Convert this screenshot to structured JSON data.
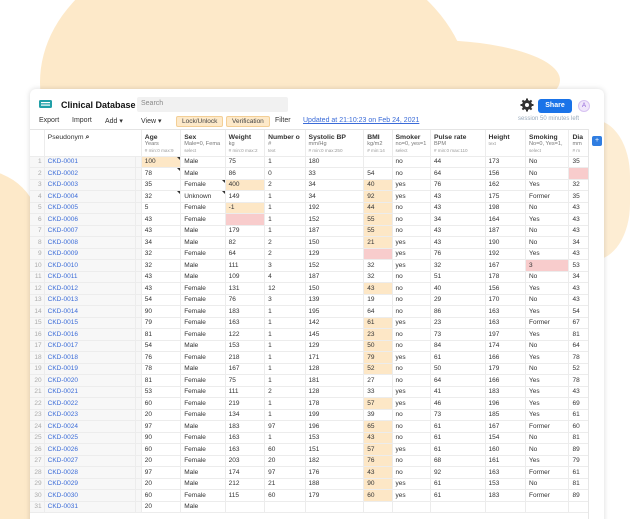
{
  "app": {
    "title": "Clinical Database",
    "search_placeholder": "Search",
    "share_label": "Share",
    "avatar": "A",
    "saved_text": "session 50 minutes left"
  },
  "toolbar": {
    "export": "Export",
    "import": "Import",
    "add": "Add ▾",
    "view": "View ▾",
    "lock": "Lock/Unlock",
    "verify": "Verification",
    "filter": "Filter",
    "updated": "Updated at 21:10:23 on Feb 24, 2021"
  },
  "columns": [
    {
      "name": "Pseudonym",
      "sub": "",
      "sub2": ""
    },
    {
      "name": "Age",
      "sub": "Years",
      "sub2": "# min:0 max:9"
    },
    {
      "name": "Sex",
      "sub": "Male=0, Fema",
      "sub2": "select"
    },
    {
      "name": "Weight",
      "sub": "kg",
      "sub2": "# min:0 max:2"
    },
    {
      "name": "Number o",
      "sub": "#",
      "sub2": "text"
    },
    {
      "name": "Systolic BP",
      "sub": "mm/Hg",
      "sub2": "# min:0 max:250"
    },
    {
      "name": "BMI",
      "sub": "kg/m2",
      "sub2": "# min:14"
    },
    {
      "name": "Smoker",
      "sub": "no=0, yes=1",
      "sub2": "select"
    },
    {
      "name": "Pulse rate",
      "sub": "BPM",
      "sub2": "# min:0 max:110"
    },
    {
      "name": "Height",
      "sub": "",
      "sub2": "text"
    },
    {
      "name": "Smoking",
      "sub": "No=0, Yes=1,",
      "sub2": "select"
    },
    {
      "name": "Dia",
      "sub": "mm",
      "sub2": "# m"
    }
  ],
  "rows": [
    [
      "1",
      "CKD-0001",
      "100",
      "Male",
      "75",
      "1",
      "180",
      "",
      "no",
      "44",
      "173",
      "No",
      "35"
    ],
    [
      "2",
      "CKD-0002",
      "78",
      "Male",
      "86",
      "0",
      "33",
      "54",
      "no",
      "64",
      "156",
      "No",
      ""
    ],
    [
      "3",
      "CKD-0003",
      "35",
      "Female",
      "400",
      "2",
      "34",
      "40",
      "yes",
      "76",
      "162",
      "Yes",
      "32"
    ],
    [
      "4",
      "CKD-0004",
      "32",
      "Unknown",
      "149",
      "1",
      "34",
      "92",
      "yes",
      "43",
      "175",
      "Former",
      "35"
    ],
    [
      "5",
      "CKD-0005",
      "5",
      "Female",
      "-1",
      "1",
      "192",
      "44",
      "no",
      "43",
      "198",
      "No",
      "43"
    ],
    [
      "6",
      "CKD-0006",
      "43",
      "Female",
      "",
      "1",
      "152",
      "55",
      "no",
      "34",
      "164",
      "Yes",
      "43"
    ],
    [
      "7",
      "CKD-0007",
      "43",
      "Male",
      "179",
      "1",
      "187",
      "55",
      "no",
      "43",
      "187",
      "No",
      "43"
    ],
    [
      "8",
      "CKD-0008",
      "34",
      "Male",
      "82",
      "2",
      "150",
      "21",
      "yes",
      "43",
      "190",
      "No",
      "34"
    ],
    [
      "9",
      "CKD-0009",
      "32",
      "Female",
      "64",
      "2",
      "129",
      "",
      "yes",
      "76",
      "192",
      "Yes",
      "43"
    ],
    [
      "10",
      "CKD-0010",
      "32",
      "Male",
      "111",
      "3",
      "152",
      "32",
      "yes",
      "32",
      "167",
      "3",
      "53"
    ],
    [
      "11",
      "CKD-0011",
      "43",
      "Male",
      "109",
      "4",
      "187",
      "32",
      "no",
      "51",
      "178",
      "No",
      "34"
    ],
    [
      "12",
      "CKD-0012",
      "43",
      "Female",
      "131",
      "12",
      "150",
      "43",
      "no",
      "40",
      "156",
      "Yes",
      "43"
    ],
    [
      "13",
      "CKD-0013",
      "54",
      "Female",
      "76",
      "3",
      "139",
      "19",
      "no",
      "29",
      "170",
      "No",
      "43"
    ],
    [
      "14",
      "CKD-0014",
      "90",
      "Female",
      "183",
      "1",
      "195",
      "64",
      "no",
      "86",
      "163",
      "Yes",
      "54"
    ],
    [
      "15",
      "CKD-0015",
      "79",
      "Female",
      "163",
      "1",
      "142",
      "61",
      "yes",
      "23",
      "163",
      "Former",
      "67"
    ],
    [
      "16",
      "CKD-0016",
      "81",
      "Female",
      "122",
      "1",
      "145",
      "23",
      "no",
      "73",
      "197",
      "Yes",
      "81"
    ],
    [
      "17",
      "CKD-0017",
      "54",
      "Male",
      "153",
      "1",
      "129",
      "50",
      "no",
      "84",
      "174",
      "No",
      "64"
    ],
    [
      "18",
      "CKD-0018",
      "76",
      "Female",
      "218",
      "1",
      "171",
      "79",
      "yes",
      "61",
      "166",
      "Yes",
      "78"
    ],
    [
      "19",
      "CKD-0019",
      "78",
      "Male",
      "167",
      "1",
      "128",
      "52",
      "no",
      "50",
      "179",
      "No",
      "52"
    ],
    [
      "20",
      "CKD-0020",
      "81",
      "Female",
      "75",
      "1",
      "181",
      "27",
      "no",
      "64",
      "166",
      "Yes",
      "78"
    ],
    [
      "21",
      "CKD-0021",
      "53",
      "Female",
      "111",
      "2",
      "128",
      "33",
      "yes",
      "41",
      "183",
      "Yes",
      "43"
    ],
    [
      "22",
      "CKD-0022",
      "60",
      "Female",
      "219",
      "1",
      "178",
      "57",
      "yes",
      "46",
      "196",
      "Yes",
      "69"
    ],
    [
      "23",
      "CKD-0023",
      "20",
      "Female",
      "134",
      "1",
      "199",
      "39",
      "no",
      "73",
      "185",
      "Yes",
      "61"
    ],
    [
      "24",
      "CKD-0024",
      "97",
      "Male",
      "183",
      "97",
      "196",
      "65",
      "no",
      "61",
      "167",
      "Former",
      "60"
    ],
    [
      "25",
      "CKD-0025",
      "90",
      "Female",
      "163",
      "1",
      "153",
      "43",
      "no",
      "61",
      "154",
      "No",
      "81"
    ],
    [
      "26",
      "CKD-0026",
      "60",
      "Female",
      "163",
      "60",
      "151",
      "57",
      "yes",
      "61",
      "160",
      "No",
      "89"
    ],
    [
      "27",
      "CKD-0027",
      "20",
      "Female",
      "203",
      "20",
      "182",
      "76",
      "no",
      "68",
      "161",
      "Yes",
      "79"
    ],
    [
      "28",
      "CKD-0028",
      "97",
      "Male",
      "174",
      "97",
      "176",
      "43",
      "no",
      "92",
      "163",
      "Former",
      "61"
    ],
    [
      "29",
      "CKD-0029",
      "20",
      "Male",
      "212",
      "21",
      "188",
      "90",
      "yes",
      "61",
      "153",
      "No",
      "81"
    ],
    [
      "30",
      "CKD-0030",
      "60",
      "Female",
      "115",
      "60",
      "179",
      "60",
      "yes",
      "61",
      "183",
      "Former",
      "89"
    ],
    [
      "31",
      "CKD-0031",
      "20",
      "Male",
      "",
      "",
      "",
      "",
      "",
      "",
      "",
      "",
      ""
    ]
  ],
  "cell_styles": {
    "highlight": [
      "0-2",
      "2-4",
      "2-7",
      "3-7",
      "4-4",
      "4-7",
      "5-7",
      "6-7",
      "7-7",
      "11-7",
      "14-7",
      "15-7",
      "16-7",
      "17-7",
      "18-7",
      "21-7",
      "23-7",
      "24-7",
      "25-7",
      "26-7",
      "27-7",
      "28-7",
      "29-7"
    ],
    "error": [
      "5-4",
      "8-7",
      "9-11",
      "1-12"
    ]
  },
  "colors": {
    "accent": "#1a73e8",
    "highlight": "#fde7c6",
    "error": "#f8cccc",
    "link": "#3a6bd8"
  }
}
